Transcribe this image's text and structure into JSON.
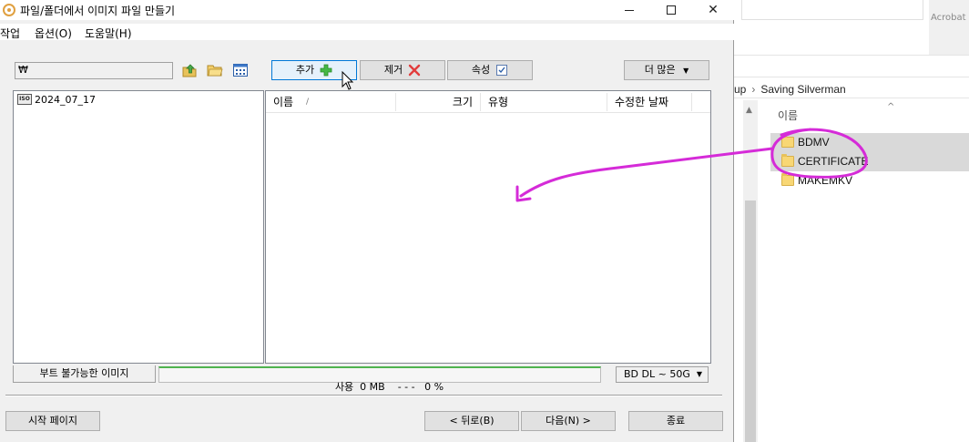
{
  "window": {
    "title": "파일/폴더에서 이미지 파일 만들기",
    "minimize_glyph": "—",
    "close_glyph": "✕"
  },
  "menu": {
    "items": [
      "작업",
      "옵션(O)",
      "도움말(H)"
    ]
  },
  "toolbar": {
    "path_value": "₩",
    "add_label": "추가",
    "remove_label": "제거",
    "properties_label": "속성",
    "more_label": "더 많은",
    "more_caret": "▼"
  },
  "tree": {
    "item_label": "2024_07_17",
    "item_icon_text": "ISO"
  },
  "list": {
    "columns": [
      "이름",
      "크기",
      "유형",
      "수정한 날짜"
    ],
    "sort_glyph": "/"
  },
  "status": {
    "boot_label": "부트 불가능한 이미지",
    "usage_text": "사용  0 MB    - - -   0 %",
    "progress_fraction": 0.0,
    "disc_type": "BD DL ~ 50G",
    "disc_caret": "▼"
  },
  "footer": {
    "start_page_label": "시작 페이지",
    "back_label": "< 뒤로(B)",
    "next_label": "다음(N) >",
    "exit_label": "종료"
  },
  "background_explorer": {
    "top_label": "Acrobat",
    "path_prefix": "up",
    "path_separator": "›",
    "path_folder": "Saving Silverman",
    "column_name": "이름",
    "sort_glyph": "^",
    "folders": [
      {
        "name": "BDMV",
        "selected": true
      },
      {
        "name": "CERTIFICATE",
        "selected": true
      },
      {
        "name": "MAKEMKV",
        "selected": false
      }
    ]
  },
  "colors": {
    "annotation": "#d52bd8",
    "add_icon": "#46b846",
    "remove_icon": "#e23c3c",
    "focus_border": "#0078d7",
    "progress_top": "#4fb34f"
  }
}
